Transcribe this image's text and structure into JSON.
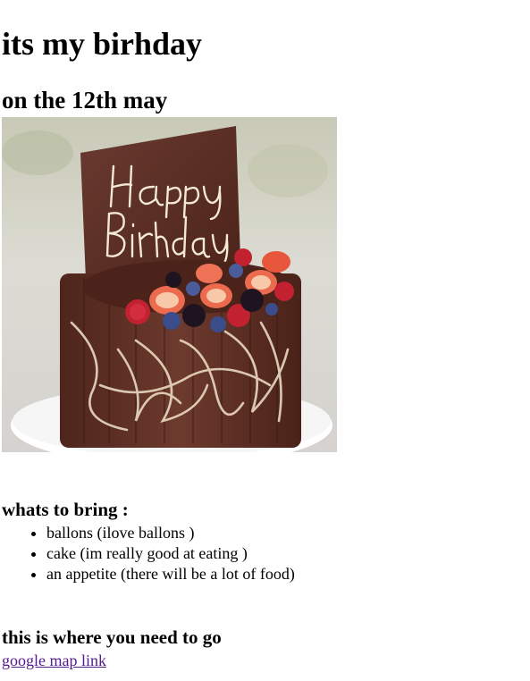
{
  "page": {
    "title": "its my birhday",
    "subtitle": "on the 12th may"
  },
  "image": {
    "icon": "birthday-cake-image",
    "inscription": "Happy Birthday"
  },
  "bring_section": {
    "heading": "whats to bring :",
    "items": [
      "ballons (ilove ballons )",
      "cake (im really good at eating )",
      "an appetite (there will be a lot of food)"
    ]
  },
  "location_section": {
    "heading": "this is where you need to go",
    "link_text": "google map link"
  },
  "colors": {
    "link_visited": "#551a8b",
    "chocolate": "#5a2c22",
    "background": "#ffffff"
  }
}
